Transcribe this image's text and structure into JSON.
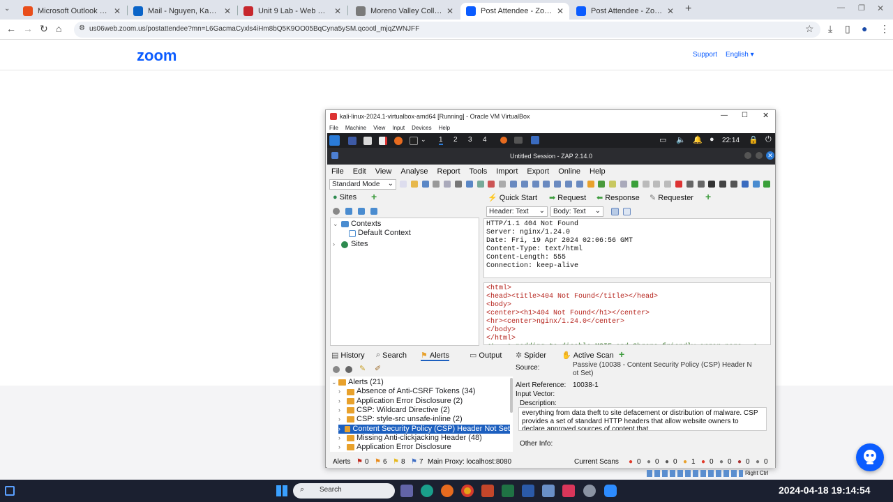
{
  "browser": {
    "tabs": [
      {
        "title": "Microsoft Outlook (formerly H",
        "color": "#e94e1b",
        "active": false
      },
      {
        "title": "Mail - Nguyen, Kasey - Outlo",
        "color": "#0a64c8",
        "active": false
      },
      {
        "title": "Unit 9 Lab - Web Server and V",
        "color": "#c7272d",
        "active": false
      },
      {
        "title": "Moreno Valley College | Advan",
        "color": "#7a7a7a",
        "active": false
      },
      {
        "title": "Post Attendee - Zoom",
        "color": "#0b5cff",
        "active": true
      },
      {
        "title": "Post Attendee - Zoom",
        "color": "#0b5cff",
        "active": false
      }
    ],
    "url": "us06web.zoom.us/postattendee?mn=L6GacmaCyxls4iHm8bQ5K9OO05BqCyna5ySM.qcootl_mjqZWNJFF"
  },
  "zoom": {
    "logo": "zoom",
    "support": "Support",
    "language": "English ▾"
  },
  "vbox": {
    "title": "kali-linux-2024.1-virtualbox-amd64 [Running] - Oracle VM VirtualBox",
    "menu": [
      "File",
      "Machine",
      "View",
      "Input",
      "Devices",
      "Help"
    ],
    "workspaces": [
      "1",
      "2",
      "3",
      "4"
    ],
    "time": "22:14"
  },
  "zap": {
    "title": "Untitled Session - ZAP 2.14.0",
    "menu": [
      "File",
      "Edit",
      "View",
      "Analyse",
      "Report",
      "Tools",
      "Import",
      "Export",
      "Online",
      "Help"
    ],
    "mode": "Standard Mode",
    "sites_tab": "Sites",
    "top_tabs": [
      "Quick Start",
      "Request",
      "Response",
      "Requester"
    ],
    "header_select": "Header: Text",
    "body_select": "Body: Text",
    "tree": {
      "contexts": "Contexts",
      "default_context": "Default Context",
      "sites": "Sites"
    },
    "response_header": "HTTP/1.1 404 Not Found\nServer: nginx/1.24.0\nDate: Fri, 19 Apr 2024 02:06:56 GMT\nContent-Type: text/html\nContent-Length: 555\nConnection: keep-alive",
    "response_body": [
      {
        "t": "<html>",
        "c": "#b5231c"
      },
      {
        "t": "<head><title>404 Not Found</title></head>",
        "c": "#b5231c"
      },
      {
        "t": "<body>",
        "c": "#b5231c"
      },
      {
        "t": "<center><h1>404 Not Found</h1></center>",
        "c": "#b5231c"
      },
      {
        "t": "<hr><center>nginx/1.24.0</center>",
        "c": "#b5231c"
      },
      {
        "t": "</body>",
        "c": "#b5231c"
      },
      {
        "t": "</html>",
        "c": "#b5231c"
      },
      {
        "t": "<!-- a padding to disable MSIE and Chrome friendly error page -->",
        "c": "#3c7a2d"
      }
    ],
    "bottom_tabs": [
      "History",
      "Search",
      "Alerts",
      "Output",
      "Spider",
      "Active Scan"
    ],
    "alerts_root": "Alerts (21)",
    "alerts": [
      "Absence of Anti-CSRF Tokens (34)",
      "Application Error Disclosure (2)",
      "CSP: Wildcard Directive (2)",
      "CSP: style-src unsafe-inline (2)",
      "Content Security Policy (CSP) Header Not Set",
      "Missing Anti-clickjacking Header (48)",
      "Application Error Disclosure"
    ],
    "selected_alert_index": 4,
    "detail": {
      "source_label": "Source:",
      "source_value": "Passive (10038 - Content Security Policy (CSP) Header N",
      "source_value2": "ot Set)",
      "ref_label": "Alert Reference:",
      "ref_value": "10038-1",
      "input_vector": "Input Vector:",
      "description_label": "Description:",
      "description": "everything from data theft to site defacement or distribution of malware. CSP provides a set of standard HTTP headers that allow website owners to declare approved sources of content that",
      "other_info": "Other Info:"
    },
    "status": {
      "alerts": "Alerts",
      "high": "0",
      "medium": "6",
      "low": "8",
      "info": "7",
      "proxy": "Main Proxy: localhost:8080",
      "current_scans": "Current Scans",
      "scan_counts": [
        "0",
        "0",
        "0",
        "1",
        "0",
        "0",
        "0",
        "0"
      ]
    },
    "right_ctrl": "Right Ctrl"
  },
  "taskbar": {
    "search": "Search",
    "datetime": "2024-04-18 19:14:54"
  }
}
